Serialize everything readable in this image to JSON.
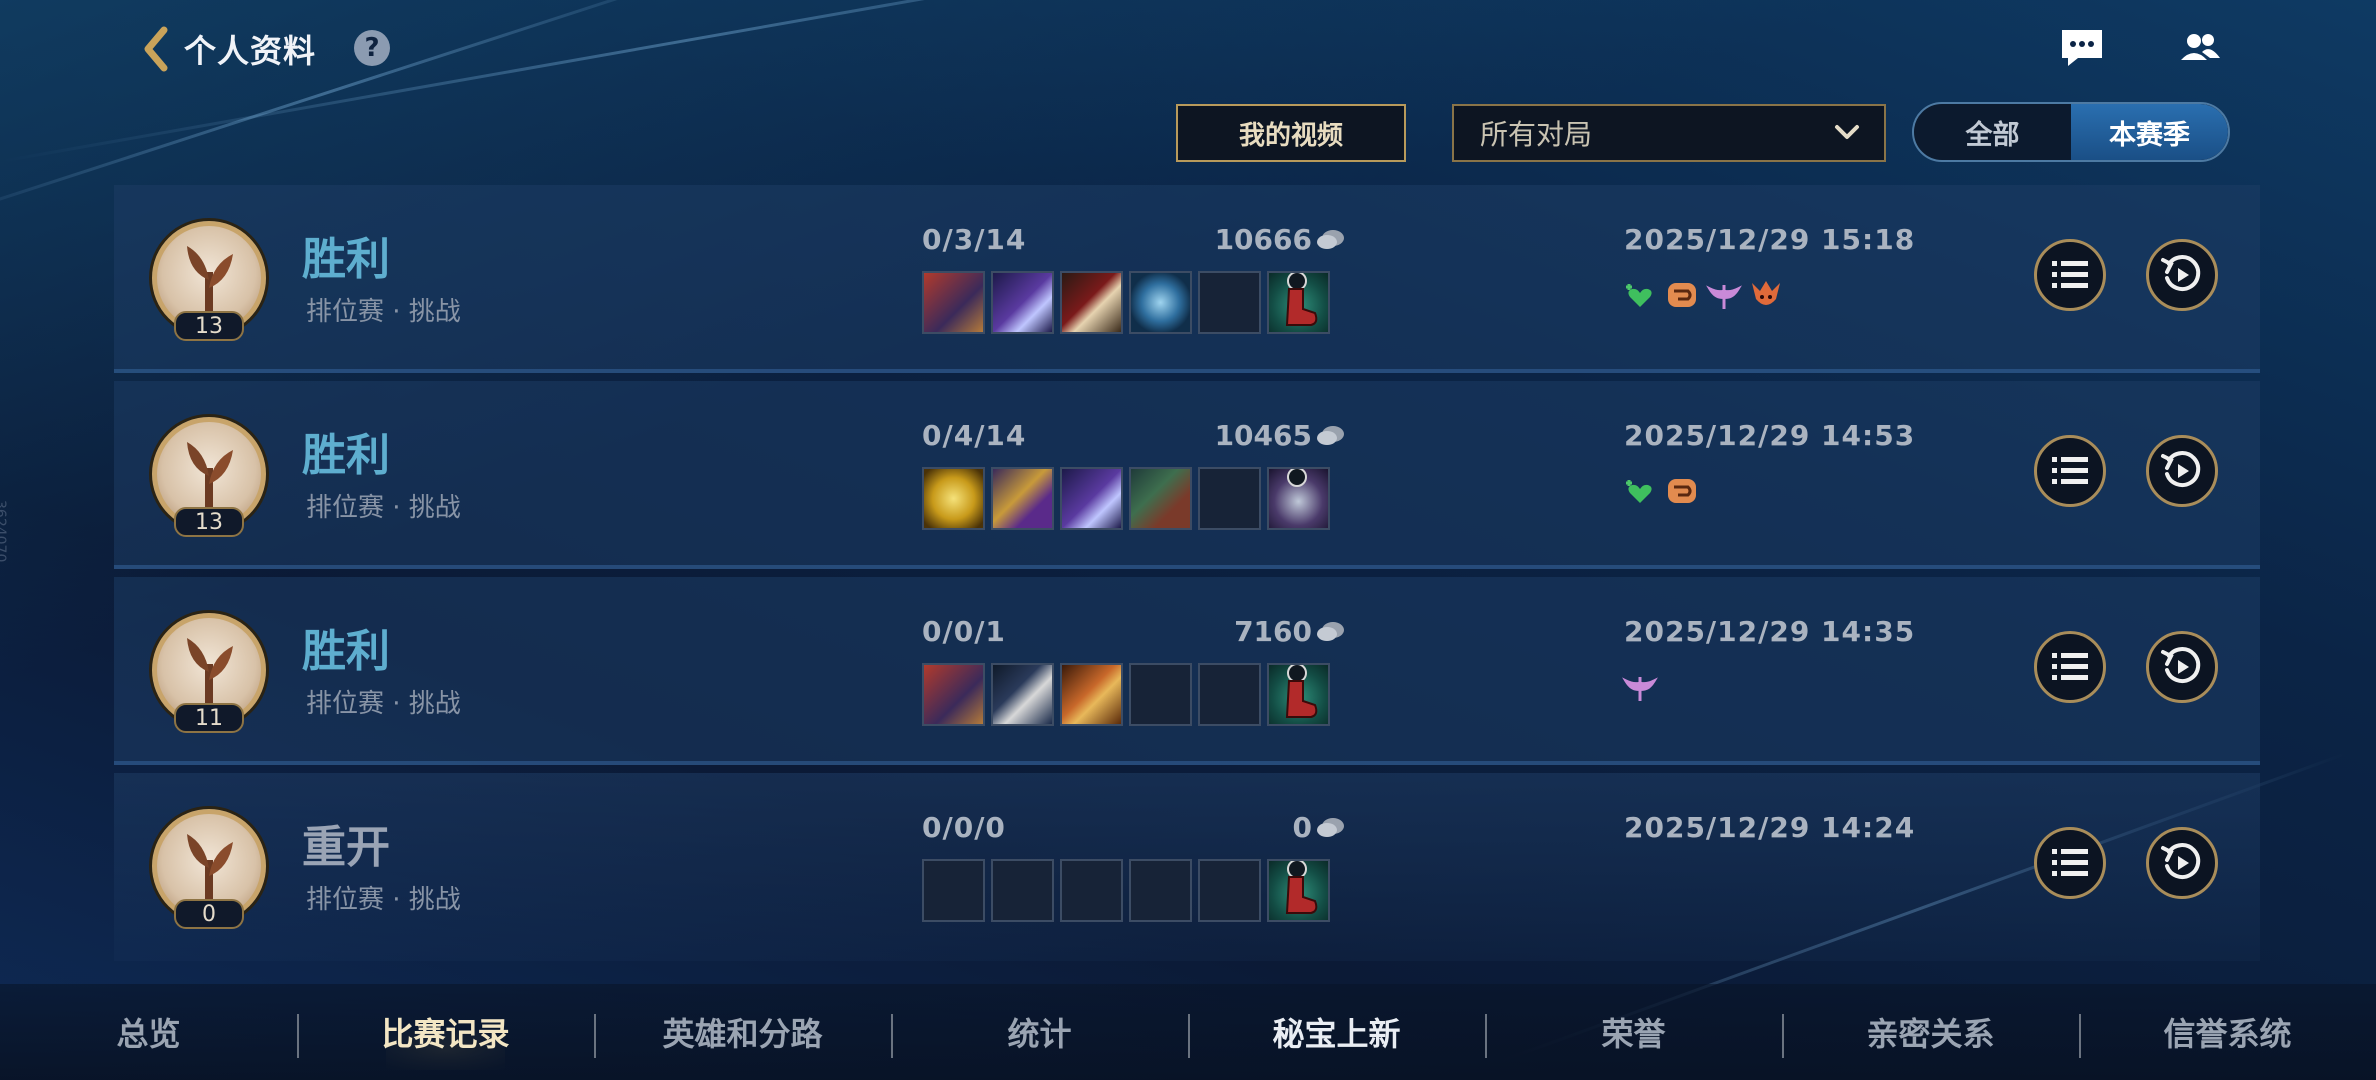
{
  "header": {
    "title": "个人资料",
    "help": "?"
  },
  "filters": {
    "my_video_label": "我的视频",
    "mode_select_value": "所有对局",
    "seg_all": "全部",
    "seg_season": "本赛季"
  },
  "matches": [
    {
      "result": "胜利",
      "mode": "排位赛 · 挑战",
      "level": "13",
      "kda": "0/3/14",
      "gold": "10666",
      "datetime": "2025/12/29 15:18"
    },
    {
      "result": "胜利",
      "mode": "排位赛 · 挑战",
      "level": "13",
      "kda": "0/4/14",
      "gold": "10465",
      "datetime": "2025/12/29 14:53"
    },
    {
      "result": "胜利",
      "mode": "排位赛 · 挑战",
      "level": "11",
      "kda": "0/0/1",
      "gold": "7160",
      "datetime": "2025/12/29 14:35"
    },
    {
      "result": "重开",
      "mode": "排位赛 · 挑战",
      "level": "0",
      "kda": "0/0/0",
      "gold": "0",
      "datetime": "2025/12/29 14:24"
    }
  ],
  "tabs": [
    "总览",
    "比赛记录",
    "英雄和分路",
    "统计",
    "秘宝上新",
    "荣誉",
    "亲密关系",
    "信誉系统"
  ],
  "watermark": "3624070",
  "colors": {
    "win": "#5eaecf",
    "redo": "#9aa4b5",
    "gold_border": "#a98d5a",
    "active_tab": "#f3e6c4"
  }
}
